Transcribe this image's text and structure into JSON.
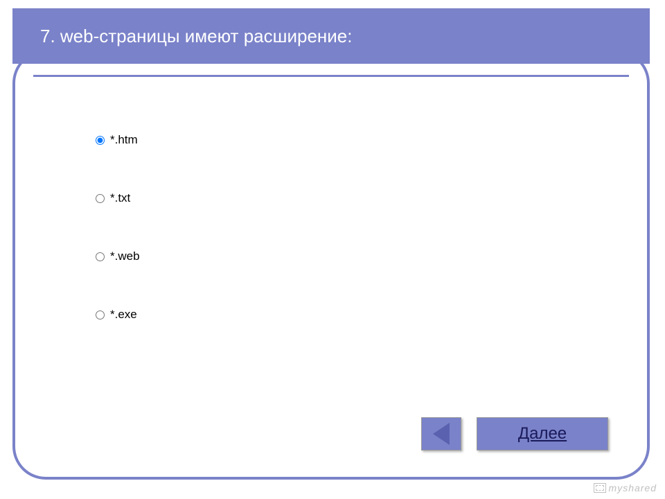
{
  "question": {
    "number": "7",
    "title": "7. web-страницы имеют расширение:",
    "options": [
      {
        "label": "*.htm",
        "selected": true
      },
      {
        "label": "*.txt",
        "selected": false
      },
      {
        "label": "*.web",
        "selected": false
      },
      {
        "label": "*.exe",
        "selected": false
      }
    ]
  },
  "navigation": {
    "next_label": "Далее"
  },
  "watermark": {
    "text": "myshared"
  }
}
